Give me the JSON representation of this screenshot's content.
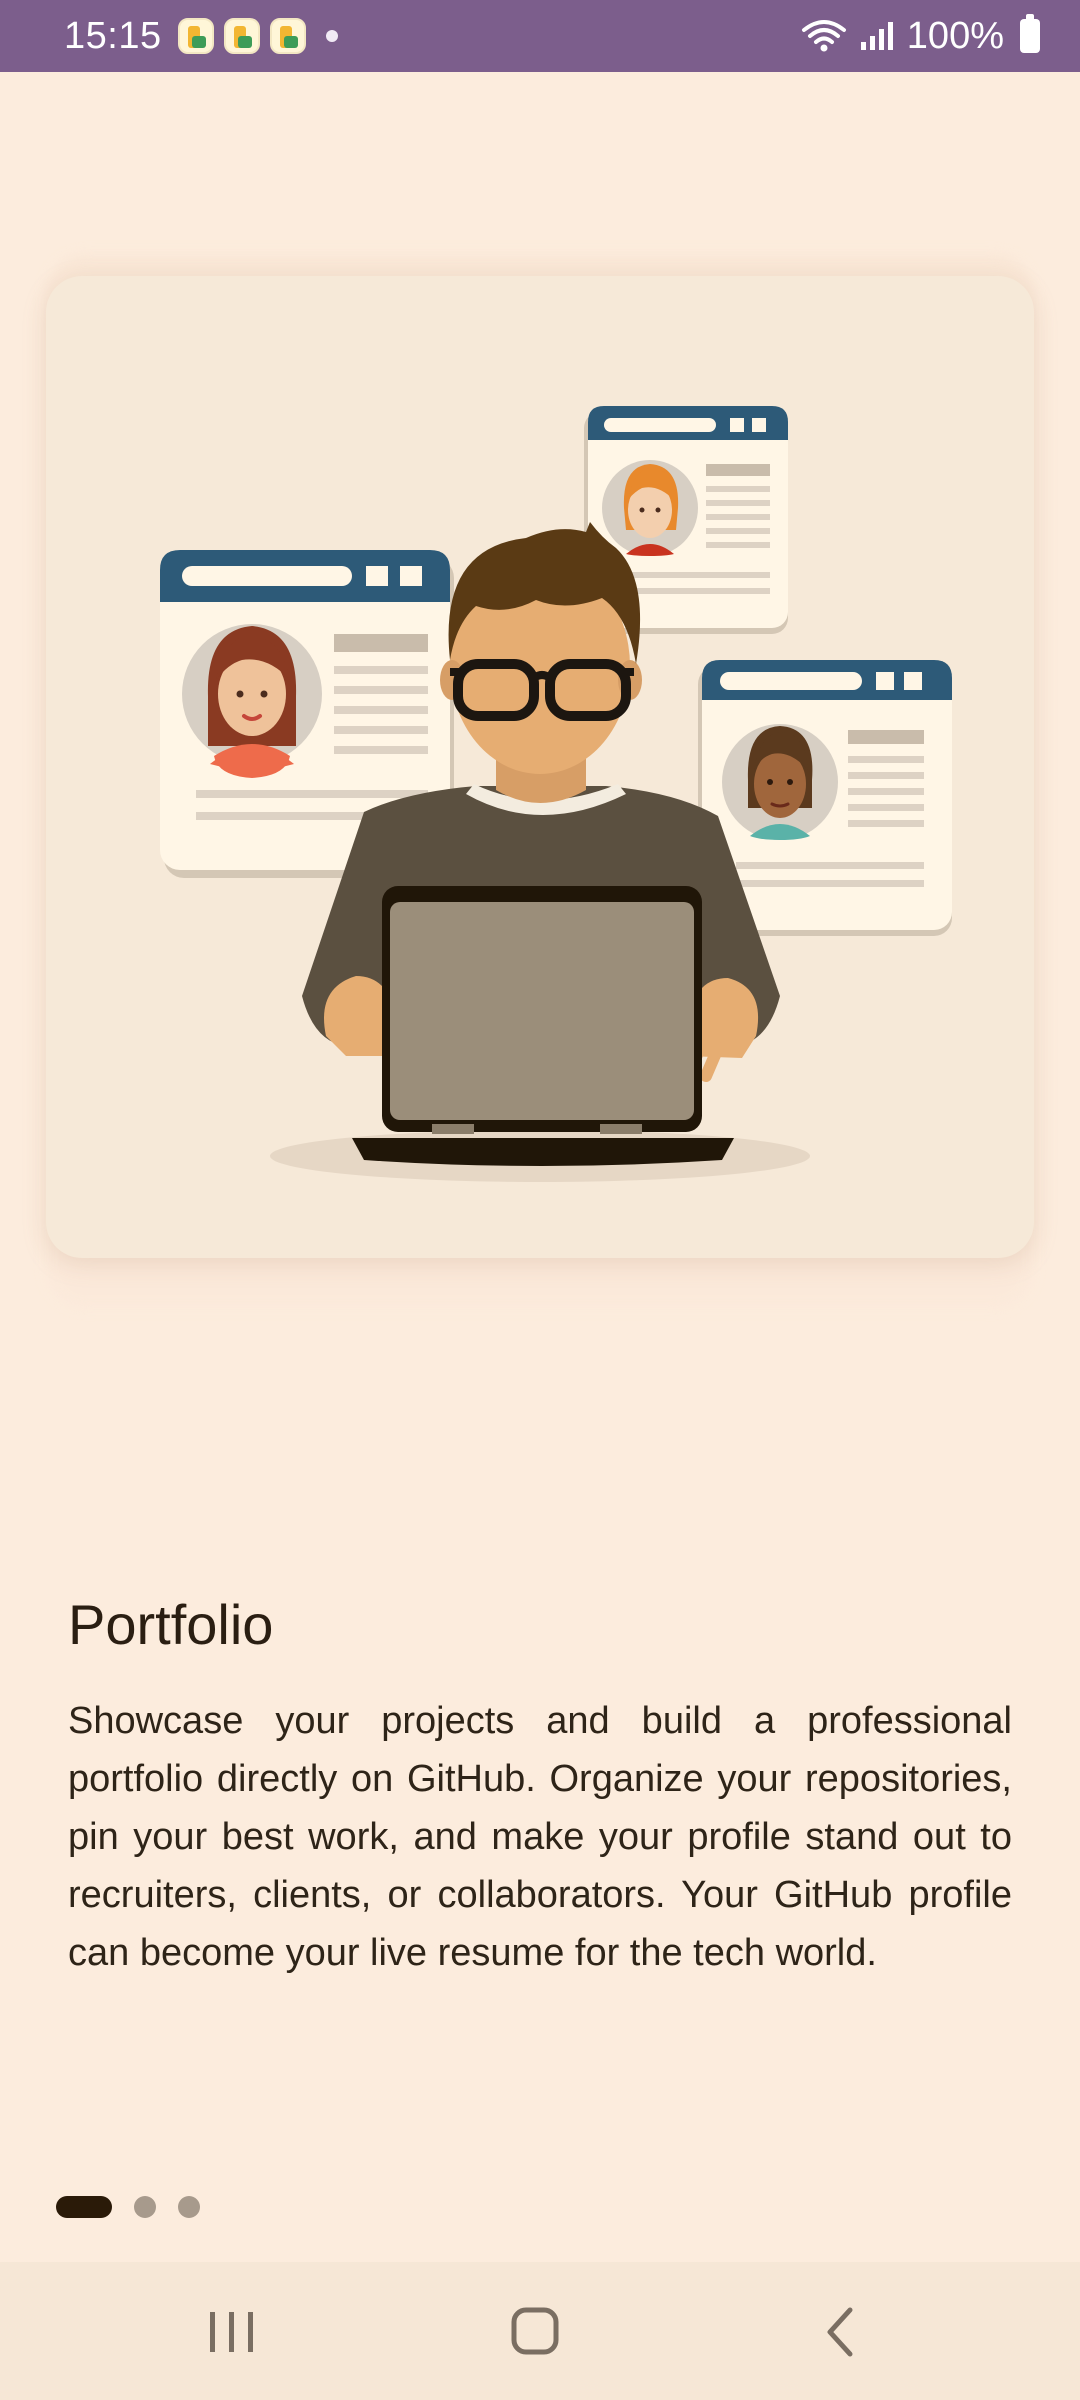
{
  "status_bar": {
    "time": "15:15",
    "battery": "100%",
    "notification_icons": [
      "app-notification-icon",
      "app-notification-icon",
      "app-notification-icon"
    ],
    "color": "#7c5e8c"
  },
  "onboarding": {
    "title": "Portfolio",
    "description": "Showcase your projects and build a professional portfolio directly on GitHub. Organize your repositories, pin your best work, and make your profile stand out to recruiters, clients, or collaborators. Your GitHub profile can become your live resume for the tech world.",
    "illustration": "developer-with-laptop-and-profile-cards",
    "page_indicator": {
      "current": 1,
      "total": 3
    }
  },
  "nav_bar": {
    "buttons": [
      "recent-apps",
      "home",
      "back"
    ]
  },
  "colors": {
    "background": "#fcecdd",
    "accent_dark": "#2a1a08",
    "card_header": "#2d5a78"
  }
}
